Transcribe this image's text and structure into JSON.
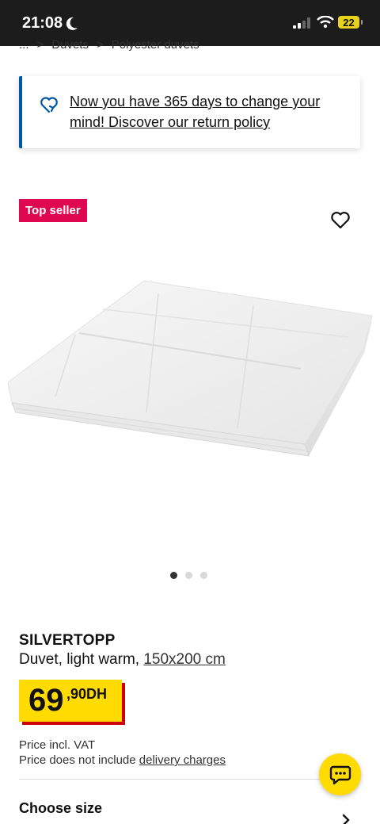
{
  "status_bar": {
    "time": "21:08",
    "battery": "22"
  },
  "breadcrumb": {
    "items": [
      "...",
      ">",
      "Duvets",
      ">",
      "Polyester duvets"
    ]
  },
  "notice": {
    "text": "Now you have 365 days to change your mind! Discover our return policy",
    "icon": "return-heart-icon",
    "accent_color": "#0058a3"
  },
  "product": {
    "badge": "Top seller",
    "badge_color": "#e00751",
    "name": "SILVERTOPP",
    "description": "Duvet, light warm,",
    "size": "150x200 cm",
    "price_integer": "69",
    "price_decimal": ",90DH",
    "price_color": "#ffdb00",
    "price_shadow_color": "#cc0008",
    "price_incl_vat": "Price incl. VAT",
    "delivery_note_prefix": "Price does not include",
    "delivery_link": "delivery charges"
  },
  "carousel": {
    "total": 3,
    "active_index": 0
  },
  "choose_size": {
    "title": "Choose size"
  }
}
